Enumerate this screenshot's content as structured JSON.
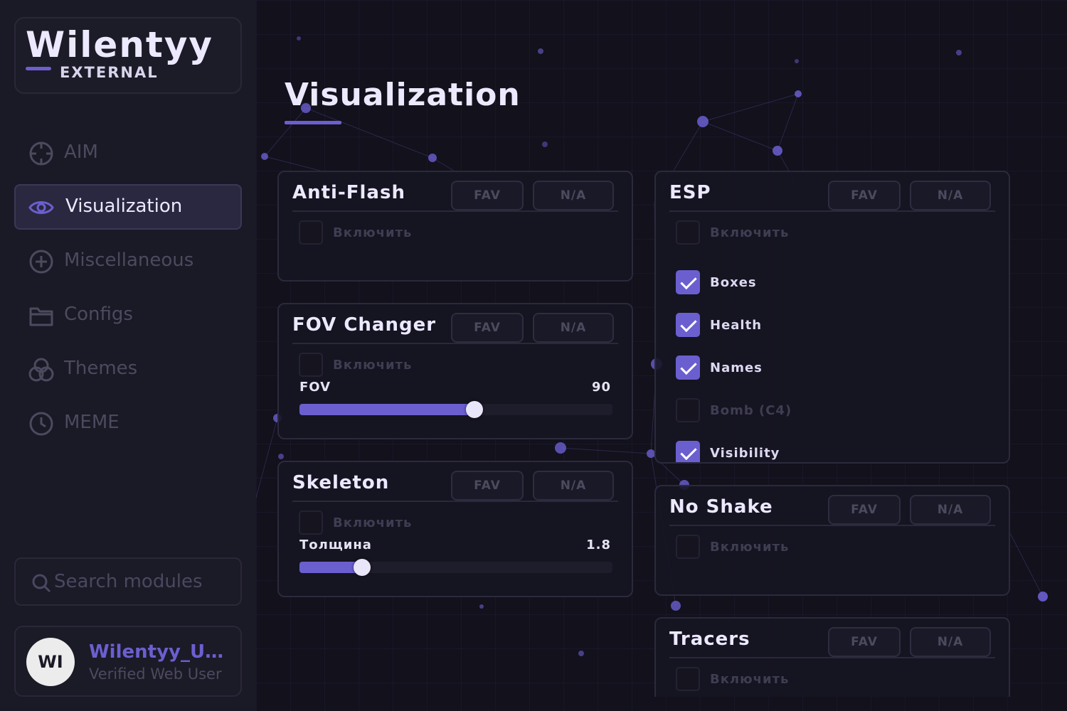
{
  "app": {
    "brand": "Wilentyy",
    "edition": "EXTERNAL"
  },
  "nav": [
    {
      "label": "AIM",
      "icon": "crosshair-icon",
      "active": false
    },
    {
      "label": "Visualization",
      "icon": "eye-icon",
      "active": true
    },
    {
      "label": "Miscellaneous",
      "icon": "plus-circle-icon",
      "active": false
    },
    {
      "label": "Configs",
      "icon": "folder-icon",
      "active": false
    },
    {
      "label": "Themes",
      "icon": "circles-icon",
      "active": false
    },
    {
      "label": "MEME",
      "icon": "clock-icon",
      "active": false
    }
  ],
  "search": {
    "placeholder": "Search modules"
  },
  "user": {
    "initials": "WI",
    "name": "Wilentyy_U...",
    "role": "Verified Web User"
  },
  "page": {
    "title": "Visualization"
  },
  "colors": {
    "accent": "#6b5fd0",
    "background": "#12111c",
    "sidebar": "#1a1926",
    "card": "#161522"
  },
  "modules": {
    "anti_flash": {
      "title": "Anti-Flash",
      "fav": "FAV",
      "na": "N/A",
      "enable_label": "Включить",
      "enabled": false
    },
    "fov_changer": {
      "title": "FOV Changer",
      "fav": "FAV",
      "na": "N/A",
      "enable_label": "Включить",
      "enabled": false,
      "slider": {
        "label": "FOV",
        "value": "90",
        "fraction": 0.56
      }
    },
    "skeleton": {
      "title": "Skeleton",
      "fav": "FAV",
      "na": "N/A",
      "enable_label": "Включить",
      "enabled": false,
      "slider": {
        "label": "Толщина",
        "value": "1.8",
        "fraction": 0.2
      }
    },
    "esp": {
      "title": "ESP",
      "fav": "FAV",
      "na": "N/A",
      "enable_label": "Включить",
      "enabled": false,
      "options": [
        {
          "label": "Boxes",
          "checked": true
        },
        {
          "label": "Health",
          "checked": true
        },
        {
          "label": "Names",
          "checked": true
        },
        {
          "label": "Bomb (C4)",
          "checked": false
        },
        {
          "label": "Visibility",
          "checked": true
        }
      ]
    },
    "no_shake": {
      "title": "No Shake",
      "fav": "FAV",
      "na": "N/A",
      "enable_label": "Включить",
      "enabled": false
    },
    "tracers": {
      "title": "Tracers",
      "fav": "FAV",
      "na": "N/A",
      "enable_label": "Включить",
      "enabled": false
    }
  }
}
